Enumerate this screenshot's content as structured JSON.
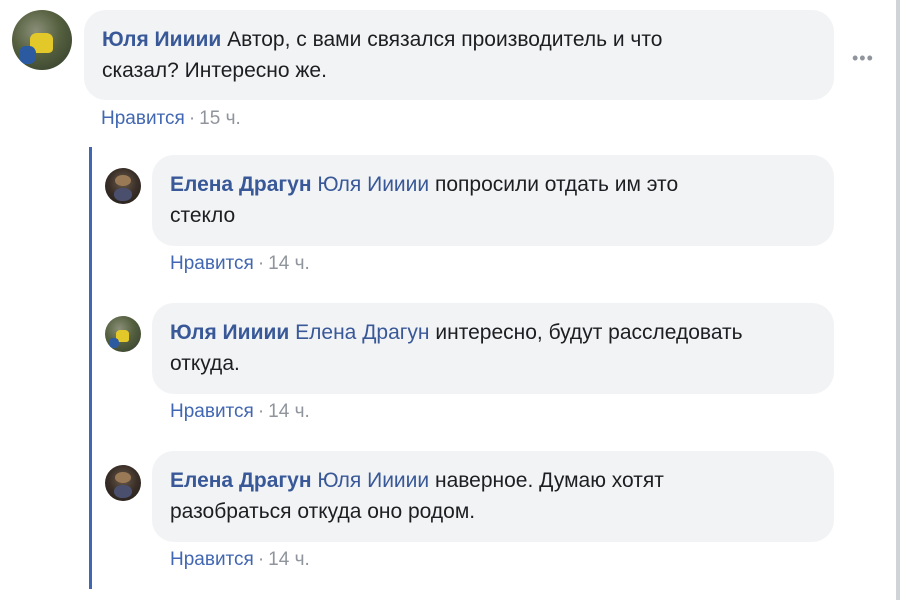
{
  "comment_main": {
    "author": "Юля Иииии",
    "text_line1": "Автор, с вами связался производитель и что",
    "text_line2": "сказал? Интересно же.",
    "like_label": "Нравится",
    "separator": "·",
    "time": "15 ч.",
    "more_label": "•••"
  },
  "replies": [
    {
      "author": "Елена Драгун",
      "mention": "Юля Иииии",
      "text_line1": "попросили отдать им это",
      "text_line2": "стекло",
      "like_label": "Нравится",
      "separator": "·",
      "time": "14 ч."
    },
    {
      "author": "Юля Иииии",
      "mention": "Елена Драгун",
      "text_line1": "интересно, будут расследовать",
      "text_line2": "откуда.",
      "like_label": "Нравится",
      "separator": "·",
      "time": "14 ч."
    },
    {
      "author": "Елена Драгун",
      "mention": "Юля Иииии",
      "text_line1": "наверное. Думаю хотят",
      "text_line2": "разобраться откуда оно родом.",
      "like_label": "Нравится",
      "separator": "·",
      "time": "14 ч."
    }
  ]
}
